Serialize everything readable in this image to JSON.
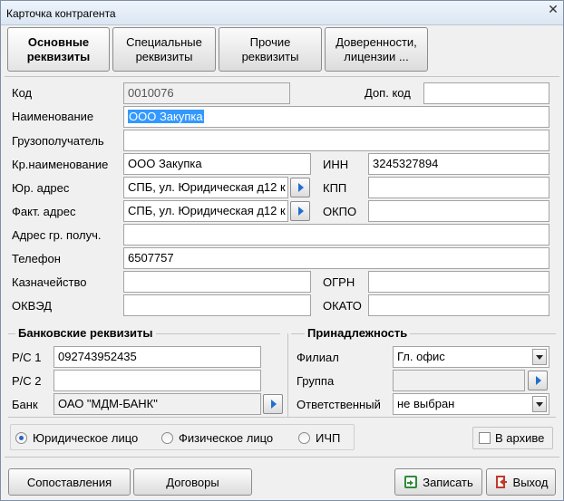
{
  "window": {
    "title": "Карточка контрагента",
    "close_glyph": "✕"
  },
  "tabs": [
    {
      "label": "Основные\nреквизиты",
      "active": true
    },
    {
      "label": "Специальные\nреквизиты",
      "active": false
    },
    {
      "label": "Прочие\nреквизиты",
      "active": false
    },
    {
      "label": "Доверенности,\nлицензии ...",
      "active": false
    }
  ],
  "fields": {
    "kod": {
      "label": "Код",
      "value": "0010076"
    },
    "dop_kod": {
      "label": "Доп. код",
      "value": ""
    },
    "naimenovanie": {
      "label": "Наименование",
      "value": "ООО Закупка"
    },
    "gruzopoluchatel": {
      "label": "Грузополучатель",
      "value": ""
    },
    "kr_naimenovanie": {
      "label": "Кр.наименование",
      "value": "ООО Закупка"
    },
    "inn": {
      "label": "ИНН",
      "value": "3245327894"
    },
    "yur_adres": {
      "label": "Юр. адрес",
      "value": "СПБ, ул. Юридическая д12 к"
    },
    "kpp": {
      "label": "КПП",
      "value": ""
    },
    "fakt_adres": {
      "label": "Факт. адрес",
      "value": "СПБ, ул. Юридическая д12 к"
    },
    "okpo": {
      "label": "ОКПО",
      "value": ""
    },
    "adres_gr": {
      "label": "Адрес гр. получ.",
      "value": ""
    },
    "telefon": {
      "label": "Телефон",
      "value": "6507757"
    },
    "kaznacheystvo": {
      "label": "Казначейство",
      "value": ""
    },
    "ogrn": {
      "label": "ОГРН",
      "value": ""
    },
    "okved": {
      "label": "ОКВЭД",
      "value": ""
    },
    "okato": {
      "label": "ОКАТО",
      "value": ""
    }
  },
  "bank": {
    "title": "Банковские реквизиты",
    "rs1": {
      "label": "Р/С 1",
      "value": "092743952435"
    },
    "rs2": {
      "label": "Р/С 2",
      "value": ""
    },
    "bank": {
      "label": "Банк",
      "value": "ОАО \"МДМ-БАНК\""
    }
  },
  "belonging": {
    "title": "Принадлежность",
    "filial": {
      "label": "Филиал",
      "value": "Гл. офис"
    },
    "gruppa": {
      "label": "Группа",
      "value": ""
    },
    "otvetstvenny": {
      "label": "Ответственный",
      "value": "не выбран"
    }
  },
  "entity_type": {
    "options": [
      "Юридическое лицо",
      "Физическое лицо",
      "ИЧП"
    ],
    "selected": 0
  },
  "archive": {
    "label": "В архиве",
    "checked": false
  },
  "buttons": {
    "sopostavleniya": "Сопоставления",
    "dogovory": "Договоры",
    "zapisat": "Записать",
    "vyhod": "Выход"
  },
  "icons": {
    "lookup": "arrow-right-icon",
    "dropdown": "chevron-down-icon",
    "save": "save-icon",
    "exit": "exit-icon"
  },
  "colors": {
    "selection": "#3399ff",
    "arrow": "#1f6fd0"
  }
}
